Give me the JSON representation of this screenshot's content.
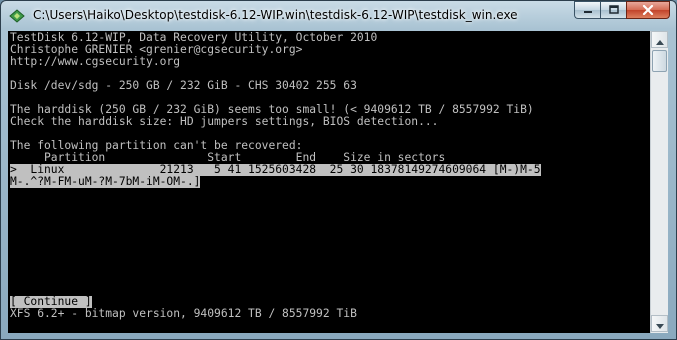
{
  "window": {
    "title": "C:\\Users\\Haiko\\Desktop\\testdisk-6.12-WIP.win\\testdisk-6.12-WIP\\testdisk_win.exe",
    "icon": "testdisk-app-icon",
    "controls": {
      "minimize_icon": "minimize-icon",
      "maximize_icon": "maximize-icon",
      "close_icon": "close-icon"
    }
  },
  "console": {
    "header": [
      "TestDisk 6.12-WIP, Data Recovery Utility, October 2010",
      "Christophe GRENIER <grenier@cgsecurity.org>",
      "http://www.cgsecurity.org"
    ],
    "disk_info": "Disk /dev/sdg - 250 GB / 232 GiB - CHS 30402 255 63",
    "warning": [
      "The harddisk (250 GB / 232 GiB) seems too small! (< 9409612 TB / 8557992 TiB)",
      "Check the harddisk size: HD jumpers settings, BIOS detection..."
    ],
    "partitions_heading": "The following partition can't be recovered:",
    "table_header": "     Partition               Start        End    Size in sectors",
    "partition_row": [
      ">  Linux              21213   5 41 1525603428  25 30 18378149274609064 [M-)M-5",
      "M-.^?M-FM-uM-?M-7bM-iM-OM-.]"
    ],
    "continue_button": "[ Continue ]",
    "status": "XFS 6.2+ - bitmap version, 9409612 TB / 8557992 TiB"
  },
  "scrollbar": {
    "up_icon": "scroll-up-arrow-icon",
    "down_icon": "scroll-down-arrow-icon"
  }
}
